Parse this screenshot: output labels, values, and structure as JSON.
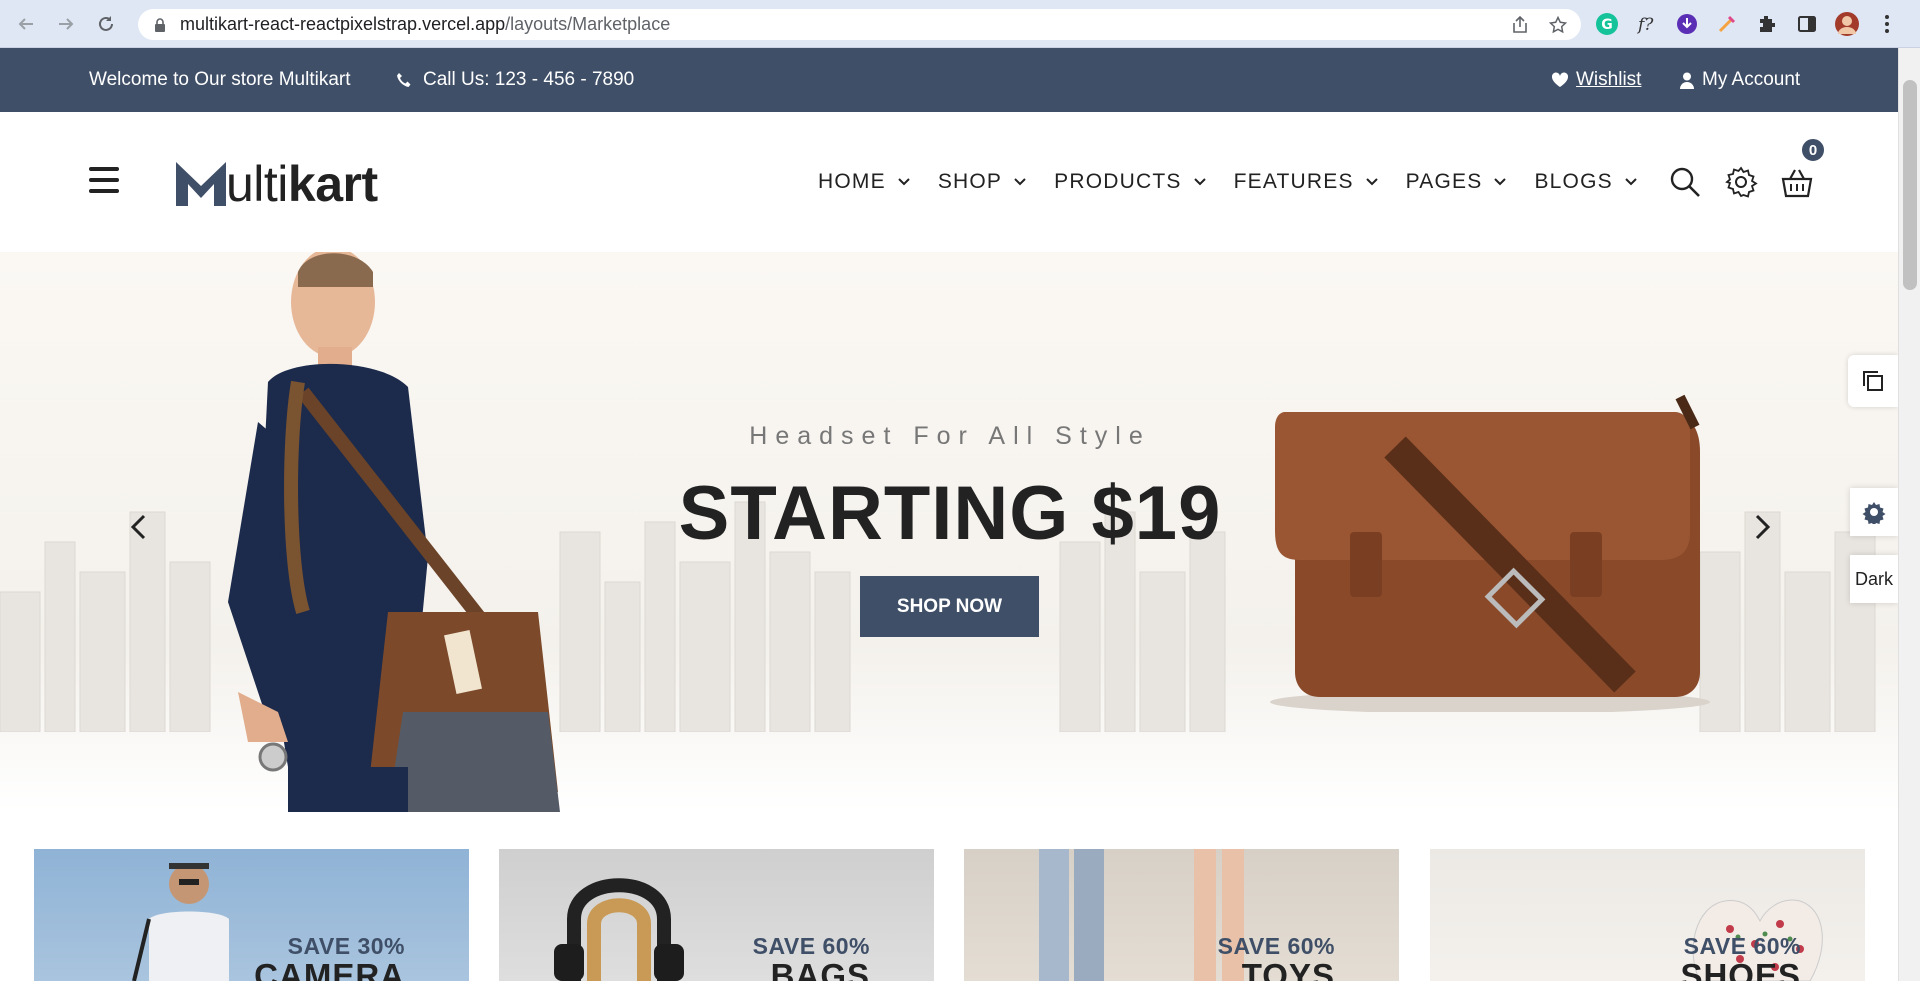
{
  "browser": {
    "url_host": "multikart-react-reactpixelstrap.vercel.app",
    "url_path": "/layouts/Marketplace"
  },
  "topbar": {
    "welcome": "Welcome to Our store Multikart",
    "call": "Call Us: 123 - 456 - 7890",
    "wishlist": "Wishlist",
    "account": "My Account"
  },
  "header": {
    "logo_light": "ulti",
    "logo_bold": "kart",
    "menu": [
      "HOME",
      "SHOP",
      "PRODUCTS",
      "FEATURES",
      "PAGES",
      "BLOGS"
    ],
    "cart_count": "0"
  },
  "hero": {
    "subtitle": "Headset For All Style",
    "title": "STARTING $19",
    "button": "SHOP NOW"
  },
  "side": {
    "dark_label": "Dark"
  },
  "banners": [
    {
      "save": "SAVE 30%",
      "name": "CAMERA"
    },
    {
      "save": "SAVE 60%",
      "name": "BAGS"
    },
    {
      "save": "SAVE 60%",
      "name": "TOYS"
    },
    {
      "save": "SAVE 60%",
      "name": "SHOES"
    }
  ],
  "colors": {
    "primary": "#3f4f67",
    "chrome": "#dfe7f4"
  }
}
